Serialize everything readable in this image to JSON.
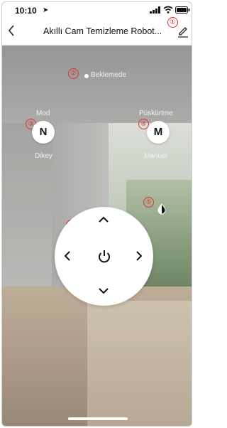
{
  "status_bar": {
    "time": "10:10",
    "location_icon": "location-arrow-icon",
    "signal_icon": "cellular-signal-icon",
    "wifi_icon": "wifi-icon",
    "battery_icon": "battery-icon"
  },
  "header": {
    "title": "Akıllı Cam Temizleme Robot...",
    "back_icon": "chevron-left-icon",
    "edit_icon": "pencil-icon"
  },
  "markers": [
    "①",
    "②",
    "③",
    "④",
    "⑤",
    "⑥"
  ],
  "status": {
    "text": "Beklemede"
  },
  "mode": {
    "label": "Mod",
    "button_letter": "N",
    "value": "Dikey"
  },
  "spray": {
    "label": "Püskürtme",
    "button_letter": "M",
    "value": "Manuel"
  },
  "water_icon": "water-drop-icon",
  "dpad": {
    "up_icon": "chevron-up-icon",
    "down_icon": "chevron-down-icon",
    "left_icon": "chevron-left-icon",
    "right_icon": "chevron-right-icon",
    "power_icon": "power-icon"
  },
  "colors": {
    "marker": "#e0302a",
    "panel": "#ffffff"
  }
}
